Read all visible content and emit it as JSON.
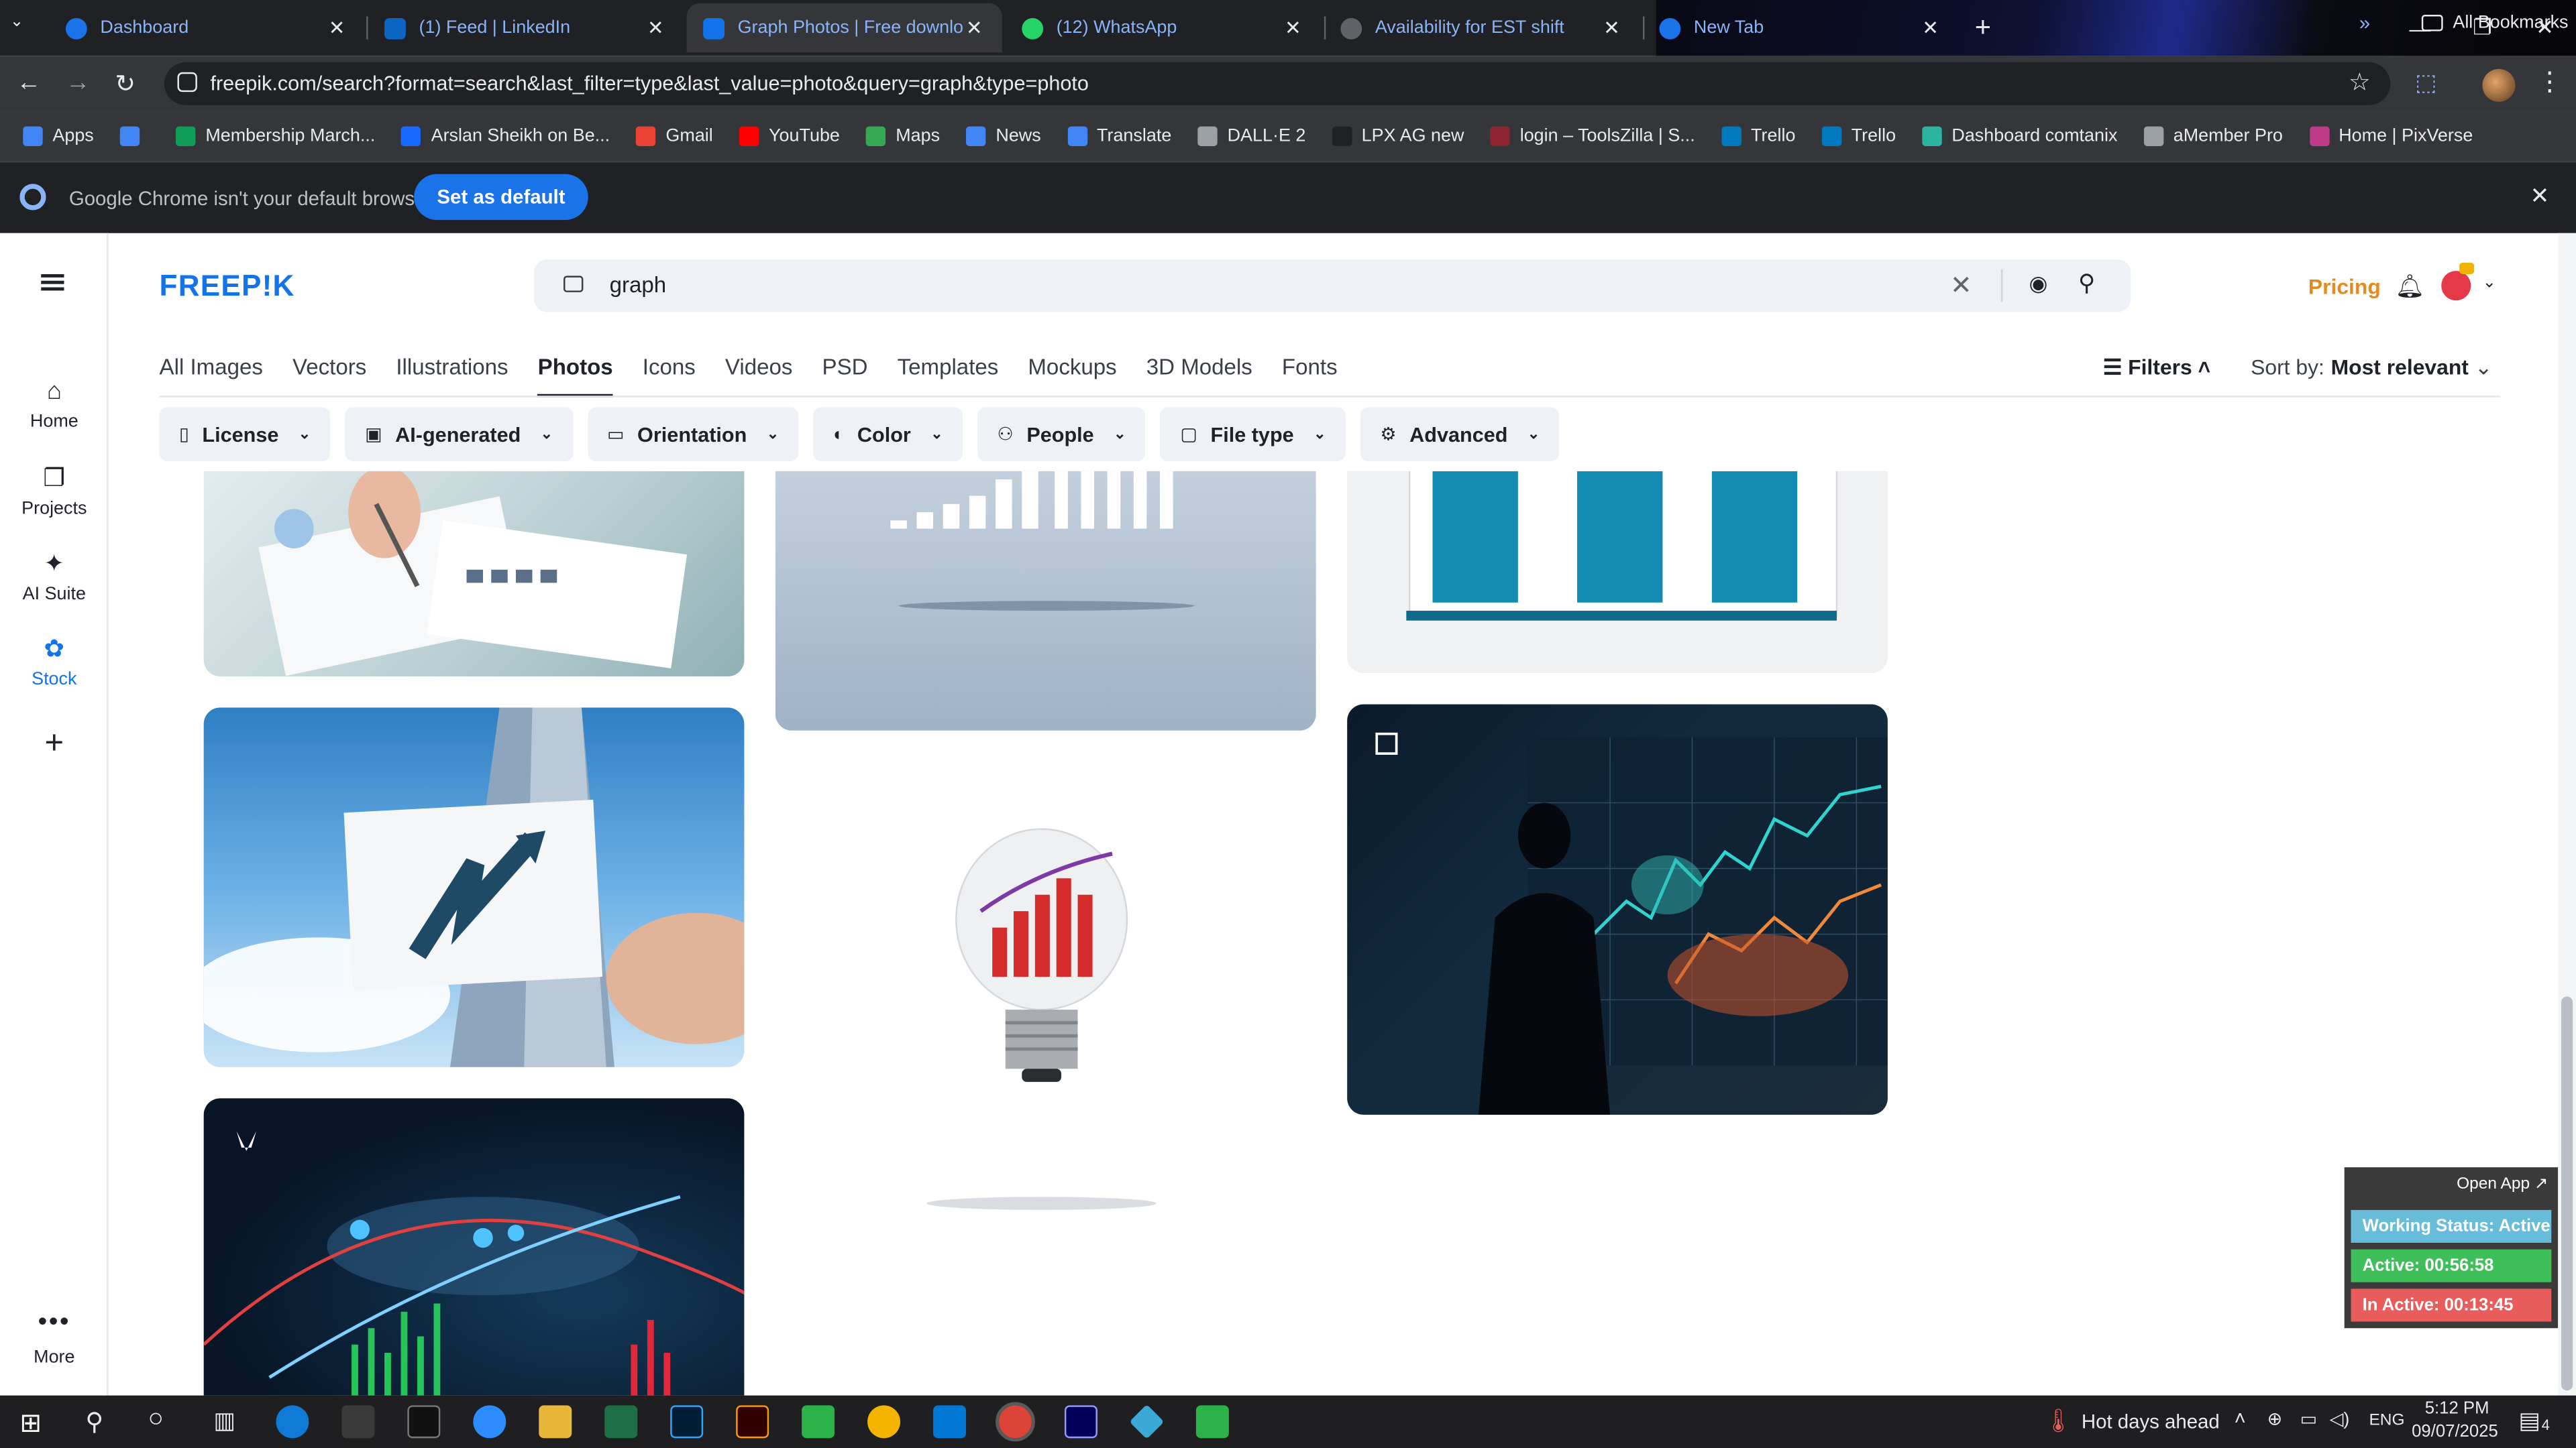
{
  "browser": {
    "tabs": [
      {
        "title": "Dashboard",
        "color": "#1a73e8"
      },
      {
        "title": "(1) Feed | LinkedIn",
        "color": "#0a66c2"
      },
      {
        "title": "Graph Photos | Free download",
        "color": "#1273eb"
      },
      {
        "title": "(12) WhatsApp",
        "color": "#25d366"
      },
      {
        "title": "Availability for EST shift",
        "color": "#5f6368"
      },
      {
        "title": "New Tab",
        "color": "#1a73e8"
      }
    ],
    "url": "freepik.com/search?format=search&last_filter=type&last_value=photo&query=graph&type=photo",
    "bookmarks": [
      {
        "label": "Apps",
        "color": "#4285f4"
      },
      {
        "label": "",
        "color": "#4285f4"
      },
      {
        "label": "Membership March...",
        "color": "#0f9d58"
      },
      {
        "label": "Arslan Sheikh on Be...",
        "color": "#1769ff"
      },
      {
        "label": "Gmail",
        "color": "#ea4335"
      },
      {
        "label": "YouTube",
        "color": "#ff0000"
      },
      {
        "label": "Maps",
        "color": "#34a853"
      },
      {
        "label": "News",
        "color": "#4285f4"
      },
      {
        "label": "Translate",
        "color": "#4285f4"
      },
      {
        "label": "DALL·E 2",
        "color": "#9aa0a6"
      },
      {
        "label": "LPX AG new",
        "color": "#202124"
      },
      {
        "label": "login – ToolsZilla | S...",
        "color": "#8e2430"
      },
      {
        "label": "Trello",
        "color": "#0079bf"
      },
      {
        "label": "Trello",
        "color": "#0079bf"
      },
      {
        "label": "Dashboard comtanix",
        "color": "#2bb5a0"
      },
      {
        "label": "aMember Pro",
        "color": "#9aa0a6"
      },
      {
        "label": "Home | PixVerse",
        "color": "#c03a8a"
      }
    ],
    "all_bookmarks": "All Bookmarks",
    "infobar": {
      "message": "Google Chrome isn't your default browser",
      "button": "Set as default"
    }
  },
  "sidebar": {
    "items": [
      {
        "label": "Home",
        "icon": "home-icon"
      },
      {
        "label": "Projects",
        "icon": "projects-icon"
      },
      {
        "label": "AI Suite",
        "icon": "ai-suite-icon"
      },
      {
        "label": "Stock",
        "icon": "stock-icon"
      }
    ],
    "more": "More"
  },
  "header": {
    "logo": "FREEP!K",
    "search_value": "graph",
    "pricing": "Pricing"
  },
  "type_tabs": [
    "All Images",
    "Vectors",
    "Illustrations",
    "Photos",
    "Icons",
    "Videos",
    "PSD",
    "Templates",
    "Mockups",
    "3D Models",
    "Fonts"
  ],
  "active_tab": "Photos",
  "filters_label": "Filters",
  "sort": {
    "label": "Sort by:",
    "value": "Most relevant"
  },
  "filter_chips": [
    "License",
    "AI-generated",
    "Orientation",
    "Color",
    "People",
    "File type",
    "Advanced"
  ],
  "tracker": {
    "open_app": "Open App ↗",
    "status": "Working Status: Active",
    "active": "Active: 00:56:58",
    "inactive": "In Active: 00:13:45",
    "colors": {
      "status": "#66bcd9",
      "active": "#3fbf5a",
      "inactive": "#e85c5c"
    }
  },
  "taskbar": {
    "weather": "Hot days ahead",
    "lang": "ENG",
    "time": "5:12 PM",
    "date": "09/07/2025",
    "notifications": "4"
  }
}
